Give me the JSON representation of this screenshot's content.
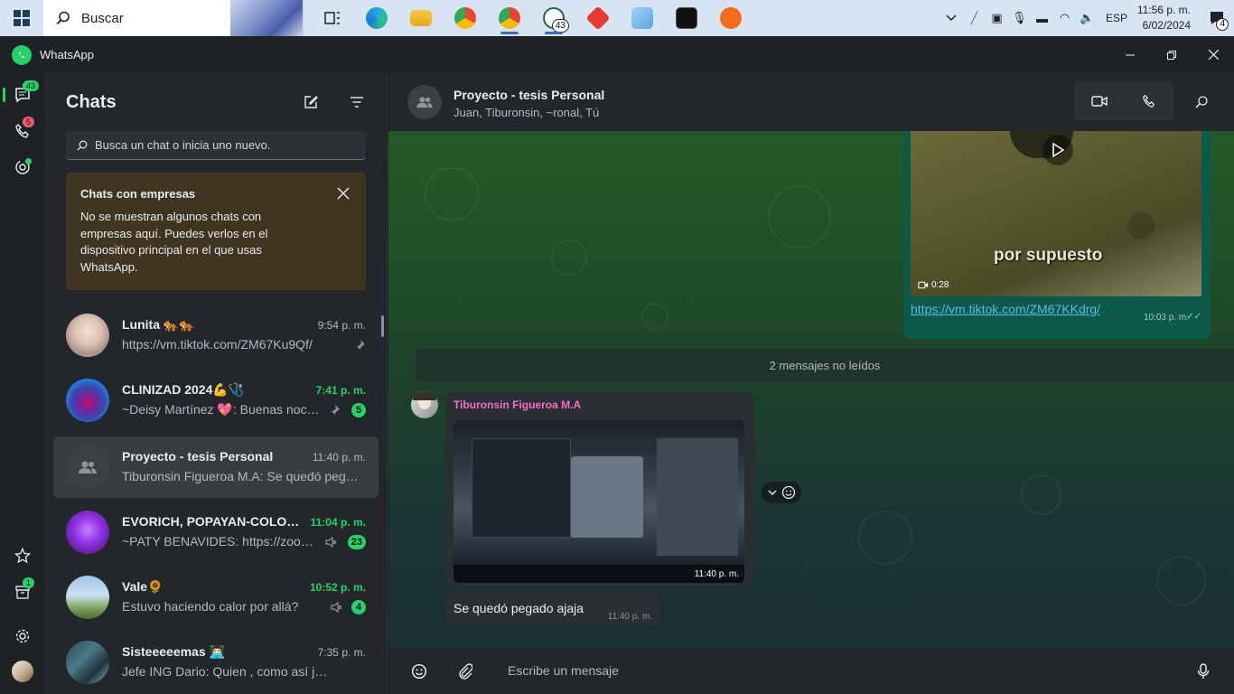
{
  "taskbar": {
    "search_label": "Buscar",
    "whatsapp_badge": "43",
    "tray_lang": "ESP",
    "clock_time": "11:56 p. m.",
    "clock_date": "6/02/2024",
    "notification_count": "4"
  },
  "titlebar": {
    "app_name": "WhatsApp"
  },
  "rail": {
    "chats_badge": "43",
    "calls_badge": "5",
    "archived_badge": "1"
  },
  "chatlist": {
    "title": "Chats",
    "search_placeholder": "Busca un chat o inicia uno nuevo.",
    "business_card": {
      "title": "Chats con empresas",
      "body": "No se muestran algunos chats con empresas aquí. Puedes verlos en el dispositivo principal en el que usas WhatsApp."
    },
    "items": [
      {
        "name": "Lunita 🐅🐅",
        "time": "9:54 p. m.",
        "message": "https://vm.tiktok.com/ZM67Ku9Qf/",
        "pinned": true,
        "badge": ""
      },
      {
        "name": "CLINIZAD 2024💪🩺",
        "time": "7:41 p. m.",
        "message": "~Deisy Martínez 💖: Buenas noches...",
        "pinned": true,
        "badge": "5"
      },
      {
        "name": "Proyecto - tesis Personal",
        "time": "11:40 p. m.",
        "message": "Tiburonsin Figueroa M.A: Se quedó pegado ajaja",
        "pinned": false,
        "badge": ""
      },
      {
        "name": "EVORICH, POPAYAN-COLOMBIA",
        "time": "11:04 p. m.",
        "message": "~PATY BENAVIDES: https://zoom.us",
        "muted": true,
        "badge": "23"
      },
      {
        "name": "Vale🌻",
        "time": "10:52 p. m.",
        "message": "Estuvo haciendo calor por allá?",
        "muted": true,
        "badge": "4"
      },
      {
        "name": "Sisteeeeemas 👨🏻‍💻",
        "time": "7:35 p. m.",
        "message": "Jefe ING Dario: Quien , como así jajaj",
        "badge": ""
      }
    ]
  },
  "conversation": {
    "name": "Proyecto - tesis Personal",
    "members": "Juan, Tiburonsin, ~ronal, Tú",
    "outgoing": {
      "video_caption": "por supuesto",
      "video_duration": "0:28",
      "link": "https://vm.tiktok.com/ZM67KKdrg/",
      "time": "10:03 p. m."
    },
    "unread_label": "2 mensajes no leídos",
    "incoming_sender": "Tiburonsin Figueroa M.A",
    "incoming_photo_time": "11:40 p. m.",
    "incoming_text": "Se quedó pegado ajaja",
    "incoming_text_time": "11:40 p. m.",
    "composer_placeholder": "Escribe un mensaje"
  },
  "colors": {
    "accent": "#25d366",
    "outgoing_bubble": "#0b5a4a",
    "incoming_bubble": "#2a2f33",
    "sender_name": "#f26ec8",
    "link": "#53bdeb"
  }
}
